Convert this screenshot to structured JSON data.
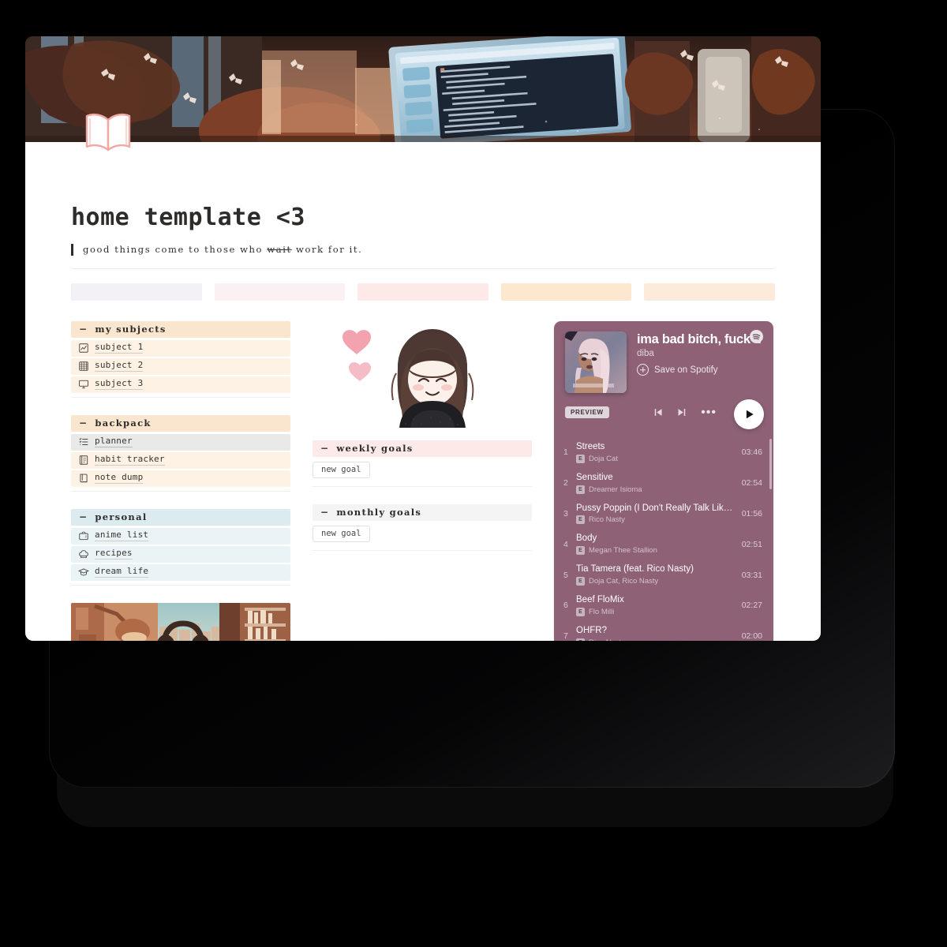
{
  "page": {
    "title": "home template <3",
    "icon": "open-book-icon",
    "quote_before": "good things come to those who ",
    "quote_strike": "wait",
    "quote_after": " work for it."
  },
  "callouts": [
    {
      "name": "callout-1",
      "color": "#f3f1f6"
    },
    {
      "name": "callout-2",
      "color": "#fbf0f2"
    },
    {
      "name": "callout-3",
      "color": "#fce9e8"
    },
    {
      "name": "callout-4",
      "color": "#fbe8cf"
    },
    {
      "name": "callout-5",
      "color": "#fceadb"
    }
  ],
  "sidebar": {
    "sections": [
      {
        "id": "my-subjects",
        "toggle": "−",
        "label": "my subjects",
        "head_color": "#fae6cf",
        "item_color": "#fdf2e3",
        "items": [
          {
            "icon": "chart-increasing-icon",
            "label": "subject 1"
          },
          {
            "icon": "abacus-icon",
            "label": "subject 2"
          },
          {
            "icon": "desktop-computer-icon",
            "label": "subject 3"
          }
        ]
      },
      {
        "id": "backpack",
        "toggle": "−",
        "label": "backpack",
        "head_color": "#fae6cf",
        "item_color": "#fdf2e3",
        "items": [
          {
            "icon": "checklist-icon",
            "label": "planner",
            "hovered": true
          },
          {
            "icon": "notebook-icon",
            "label": "habit tracker"
          },
          {
            "icon": "book-icon",
            "label": "note dump"
          }
        ]
      },
      {
        "id": "personal",
        "toggle": "−",
        "label": "personal",
        "head_color": "#dcebf0",
        "item_color": "#eaf4f7",
        "items": [
          {
            "icon": "television-icon",
            "label": "anime list"
          },
          {
            "icon": "chef-hat-icon",
            "label": "recipes"
          },
          {
            "icon": "graduation-cap-icon",
            "label": "dream life"
          }
        ]
      }
    ]
  },
  "goals": {
    "sections": [
      {
        "id": "weekly-goals",
        "toggle": "−",
        "label": "weekly goals",
        "head_color": "#fce9e8",
        "button": "new goal"
      },
      {
        "id": "monthly-goals",
        "toggle": "−",
        "label": "monthly goals",
        "head_color": "#f4f4f4",
        "button": "new goal"
      }
    ]
  },
  "spotify": {
    "logo": "spotify-logo-icon",
    "cover_alt": "album-cover",
    "track_title": "ima bad bitch, fuck th",
    "owner": "diba",
    "save_label": "Save on Spotify",
    "preview_badge": "PREVIEW",
    "accent": "#8e6177",
    "controls": {
      "previous": "previous-track-icon",
      "next": "next-track-icon",
      "more": "•••",
      "play": "play-icon"
    },
    "explicit_badge": "E",
    "tracks": [
      {
        "num": "1",
        "name": "Streets",
        "artist": "Doja Cat",
        "time": "03:46"
      },
      {
        "num": "2",
        "name": "Sensitive",
        "artist": "Dreamer Isioma",
        "time": "02:54"
      },
      {
        "num": "3",
        "name": "Pussy Poppin (I Don't Really Talk Like T…",
        "artist": "Rico Nasty",
        "time": "01:56"
      },
      {
        "num": "4",
        "name": "Body",
        "artist": "Megan Thee Stallion",
        "time": "02:51"
      },
      {
        "num": "5",
        "name": "Tia Tamera (feat. Rico Nasty)",
        "artist": "Doja Cat, Rico Nasty",
        "time": "03:31"
      },
      {
        "num": "6",
        "name": "Beef FloMix",
        "artist": "Flo Milli",
        "time": "02:27"
      },
      {
        "num": "7",
        "name": "OHFR?",
        "artist": "Rico Nasty",
        "time": "02:00"
      }
    ]
  }
}
